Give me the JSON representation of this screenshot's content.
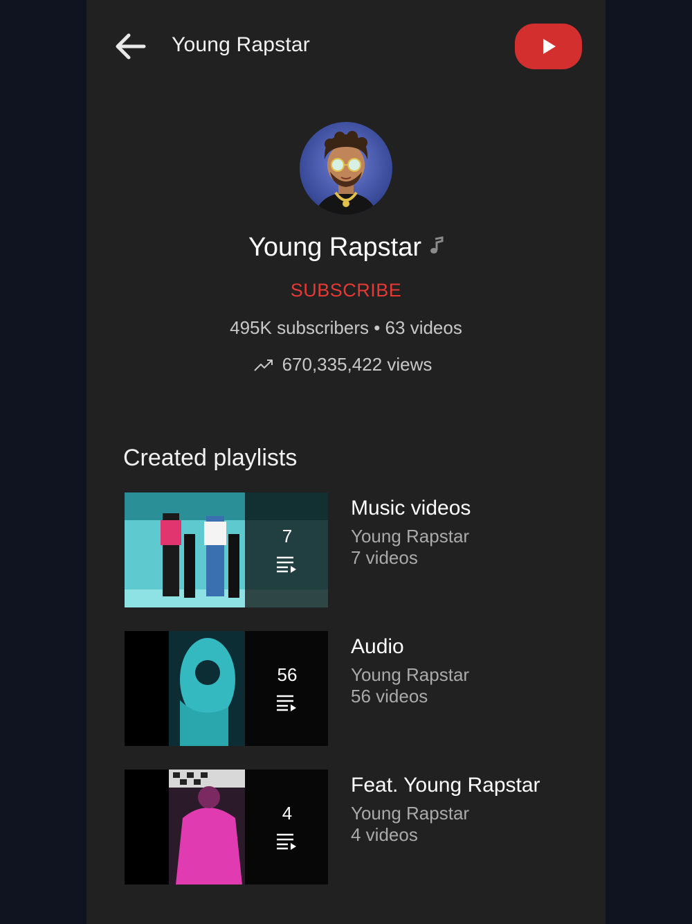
{
  "header": {
    "title": "Young Rapstar",
    "back_icon": "arrow-left-icon",
    "logo_icon": "youtube-play-icon",
    "logo_color": "#d32f2f"
  },
  "channel": {
    "name": "Young Rapstar",
    "badge_icon": "music-note-icon",
    "subscribe_label": "SUBSCRIBE",
    "subscribe_color": "#e53935",
    "stats": "495K subscribers • 63 videos",
    "views": "670,335,422 views",
    "views_icon": "trending-up-icon"
  },
  "playlists_section": {
    "title": "Created playlists",
    "items": [
      {
        "title": "Music videos",
        "owner": "Young Rapstar",
        "count_label": "7 videos",
        "thumb_count": "7",
        "thumb_icon": "playlist-icon"
      },
      {
        "title": "Audio",
        "owner": "Young Rapstar",
        "count_label": "56 videos",
        "thumb_count": "56",
        "thumb_icon": "playlist-icon"
      },
      {
        "title": "Feat. Young Rapstar",
        "owner": "Young Rapstar",
        "count_label": "4 videos",
        "thumb_count": "4",
        "thumb_icon": "playlist-icon"
      }
    ]
  }
}
